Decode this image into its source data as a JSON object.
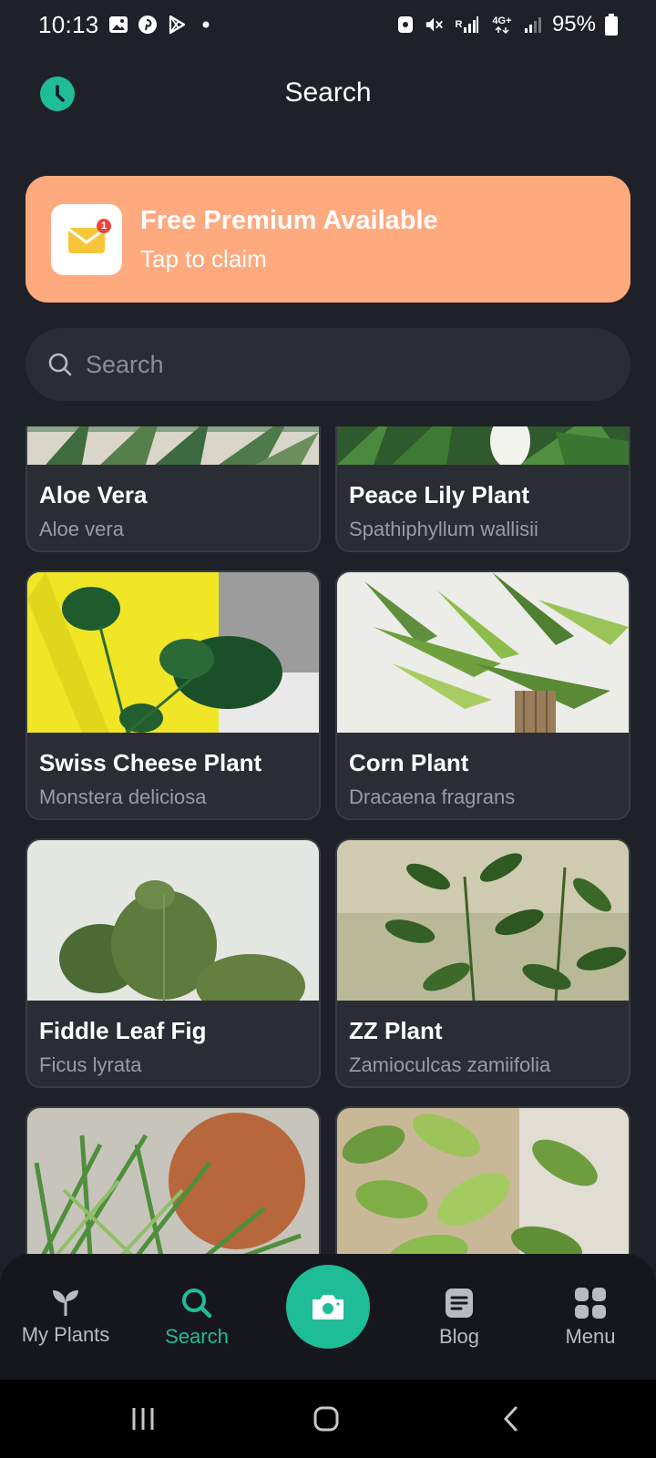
{
  "status_bar": {
    "time": "10:13",
    "signal_label": "R",
    "network_label": "4G+",
    "battery": "95%"
  },
  "header": {
    "title": "Search"
  },
  "banner": {
    "title": "Free Premium Available",
    "subtitle": "Tap to claim",
    "badge": "1"
  },
  "search": {
    "placeholder": "Search",
    "value": ""
  },
  "plants": [
    {
      "name": "Aloe Vera",
      "scientific": "Aloe vera"
    },
    {
      "name": "Peace Lily Plant",
      "scientific": "Spathiphyllum wallisii"
    },
    {
      "name": "Swiss Cheese Plant",
      "scientific": "Monstera deliciosa"
    },
    {
      "name": "Corn Plant",
      "scientific": "Dracaena fragrans"
    },
    {
      "name": "Fiddle Leaf Fig",
      "scientific": "Ficus lyrata"
    },
    {
      "name": "ZZ Plant",
      "scientific": "Zamioculcas zamiifolia"
    }
  ],
  "nav": {
    "my_plants": "My Plants",
    "search": "Search",
    "blog": "Blog",
    "menu": "Menu",
    "active": "search"
  },
  "colors": {
    "background": "#1f2128",
    "accent": "#1fbc98",
    "banner": "#ffa97e",
    "card": "#2b2d35"
  }
}
